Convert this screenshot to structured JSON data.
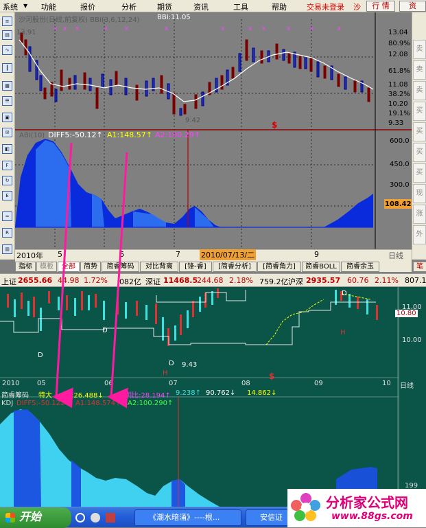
{
  "menubar": {
    "items": [
      "系统",
      "功能",
      "报价",
      "分析",
      "期货",
      "资讯",
      "工具",
      "帮助"
    ],
    "alert": "交易未登录",
    "alert_tail": "沙",
    "btn_market": "行 情",
    "btn_info": "资"
  },
  "top_chart": {
    "header": "沙河股份(日线,前复权) BBI(3,6,12,24)",
    "bbi": "BBI:11.05",
    "high_label": "13.91",
    "low_label": "9.42",
    "right_scale": [
      "13.04",
      "80.9%",
      "12.08",
      "61.8%",
      "11.08",
      "38.2%",
      "10.20",
      "19.1%",
      "9.33"
    ]
  },
  "indicator_chart": {
    "name": "ABI(10)",
    "diff5": "DIFF5:-50.12↑",
    "a1": "A1:148.57↑",
    "a2": "A2:100.29↑",
    "right_scale": [
      "600.0",
      "450.0",
      "300.0"
    ],
    "value_box": "108.42"
  },
  "date_axis": {
    "year": "2010年",
    "marks": [
      "5",
      "6",
      "7",
      "8",
      "9"
    ],
    "highlight": "2010/07/13/二",
    "period": "日线"
  },
  "tabs": {
    "items": [
      "指标",
      "模板",
      "全部",
      "简势",
      "简睿筹码",
      "对比背离",
      "[锋-睿]",
      "[简睿分析]",
      "[简睿角力]",
      "简睿BOLL",
      "简睿余玉"
    ],
    "end": "笔"
  },
  "index_bar": {
    "sh_name": "上证",
    "sh_val": "2655.66",
    "sh_chg": "44.98",
    "sh_pct": "1.72%",
    "sh_amt": "082亿",
    "sz_name": "深证",
    "sz_val": "11468.5",
    "sz_chg": "244.68",
    "sz_pct": "2.18%",
    "sz_amt": "759.2亿",
    "hs_name": "沪深",
    "hs_val": "2935.57",
    "hs_chg": "60.76",
    "hs_pct": "2.11%",
    "hs_amt": "807.1"
  },
  "lower_chart": {
    "right_scale": [
      "11.00",
      "10.80",
      "10.00"
    ],
    "low_label": "9.43",
    "letter_h": "H",
    "letter_d": "D",
    "dates": [
      "2010",
      "05",
      "06",
      "07",
      "08",
      "09",
      "10"
    ],
    "period": "日线",
    "legend_name": "简睿筹码",
    "legend_a": "特大",
    "legend_b": "比:26.488↓",
    "legend_c": "户例比:28.194↑",
    "legend_d": "9.238↑",
    "legend_e": "90.762↓",
    "legend_f": "14.862↓",
    "kdj_name": "KDJ",
    "kdj_diff": "DIFF5:-50.122↑",
    "kdj_a1": "A1:148.574↑",
    "kdj_a2": "A2:100.290↑",
    "kdj_right": "199"
  },
  "taskbar": {
    "start": "开始",
    "task1": "《潮水暗涌》----根...",
    "task2": "安信证"
  },
  "logo": {
    "text": "分析家公式网",
    "url": "www.88gs.com"
  }
}
